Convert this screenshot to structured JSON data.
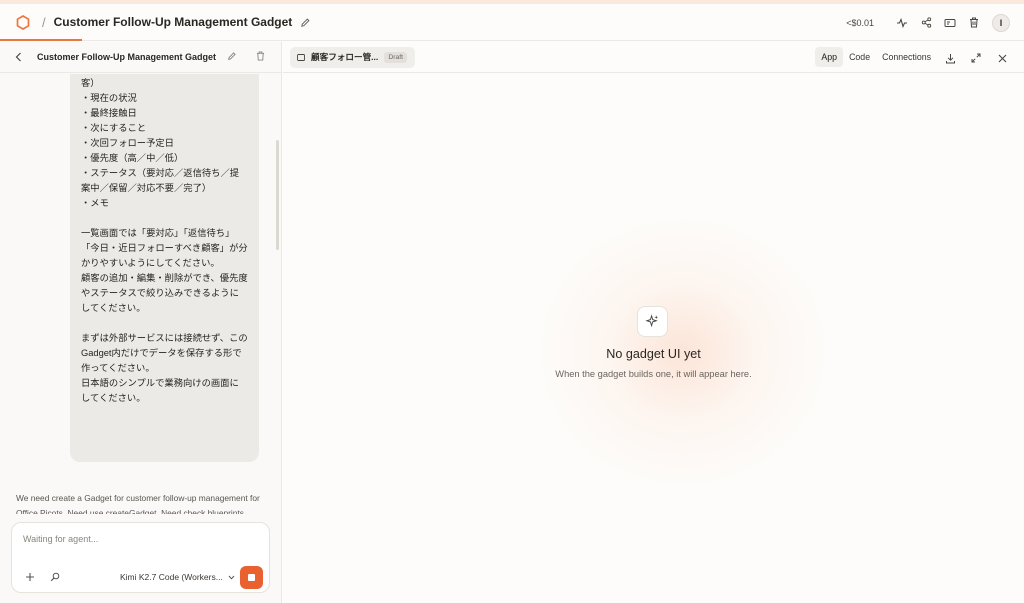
{
  "header": {
    "title": "Customer Follow-Up Management Gadget",
    "cost": "<$0.01",
    "avatar_initial": "I"
  },
  "left_panel": {
    "title": "Customer Follow-Up Management Gadget",
    "message_lines": [
      "客）",
      "・現在の状況",
      "・最終接触日",
      "・次にすること",
      "・次回フォロー予定日",
      "・優先度（高／中／低）",
      "・ステータス（要対応／返信待ち／提案中／保留／対応不要／完了）",
      "・メモ"
    ],
    "message_paragraph2": "一覧画面では「要対応」「返信待ち」「今日・近日フォローすべき顧客」が分かりやすいようにしてください。\n顧客の追加・編集・削除ができ、優先度やステータスで絞り込みできるようにしてください。",
    "message_paragraph3": "まずは外部サービスには接続せず、このGadget内だけでデータを保存する形で作ってください。\n日本語のシンプルで業務向けの画面にしてください。",
    "agent_text": "We need create a Gadget for customer follow-up management for Office Picots. Need use createGadget. Need check blueprints. There's no existing gadgets. Request is a tracker/management. Not one of standard output formats",
    "composer": {
      "placeholder": "Waiting for agent...",
      "model": "Kimi K2.7 Code (Workers..."
    }
  },
  "right_panel": {
    "tab_label": "顧客フォロー管...",
    "draft_badge": "Draft",
    "view_tabs": [
      "App",
      "Code",
      "Connections"
    ],
    "active_view": "App",
    "empty_title": "No gadget UI yet",
    "empty_subtitle": "When the gadget builds one, it will appear here."
  },
  "colors": {
    "accent": "#e9773d",
    "stop_button": "#e9612f"
  }
}
